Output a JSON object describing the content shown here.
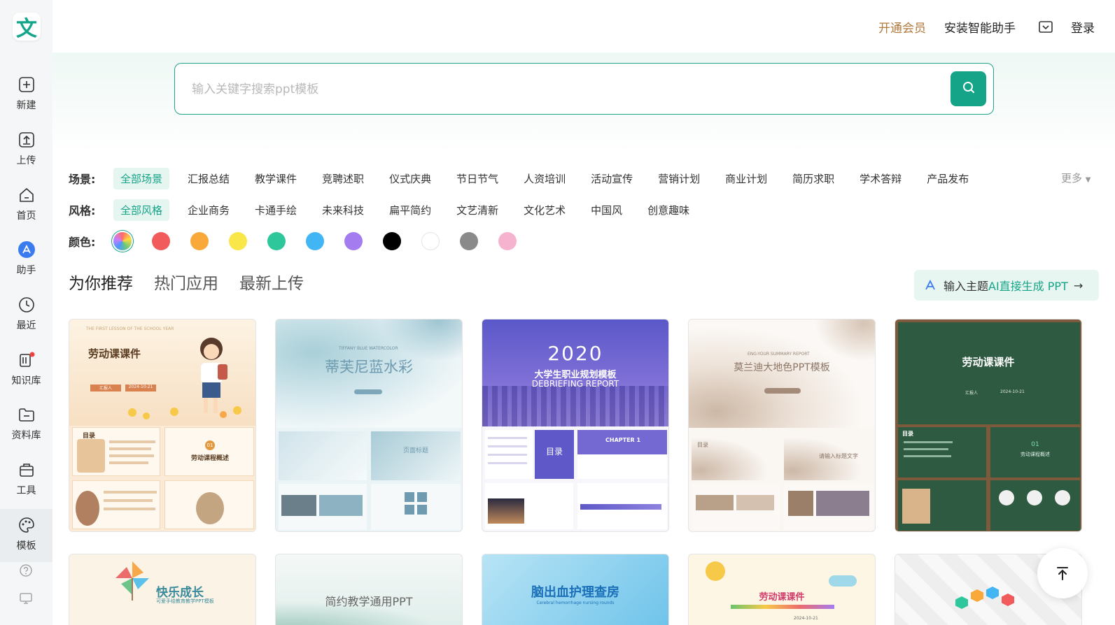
{
  "sidebar": {
    "logo": "文",
    "items": [
      {
        "label": "新建"
      },
      {
        "label": "上传"
      },
      {
        "label": "首页"
      },
      {
        "label": "助手"
      },
      {
        "label": "最近"
      },
      {
        "label": "知识库"
      },
      {
        "label": "资料库"
      },
      {
        "label": "工具"
      },
      {
        "label": "模板"
      }
    ],
    "help_icon": "question-icon",
    "device_icon": "monitor-icon"
  },
  "header": {
    "vip": "开通会员",
    "install": "安装智能助手",
    "login": "登录"
  },
  "search": {
    "placeholder": "输入关键字搜索ppt模板"
  },
  "filters": {
    "scene_label": "场景:",
    "scenes": [
      "全部场景",
      "汇报总结",
      "教学课件",
      "竞聘述职",
      "仪式庆典",
      "节日节气",
      "人资培训",
      "活动宣传",
      "营销计划",
      "商业计划",
      "简历求职",
      "学术答辩",
      "产品发布"
    ],
    "more": "更多",
    "style_label": "风格:",
    "styles": [
      "全部风格",
      "企业商务",
      "卡通手绘",
      "未来科技",
      "扁平简约",
      "文艺清新",
      "文化艺术",
      "中国风",
      "创意趣味"
    ],
    "color_label": "颜色:",
    "colors": [
      "all",
      "#f25b5b",
      "#f8a93a",
      "#f9e74a",
      "#2ec79b",
      "#42b6f5",
      "#a57cf0",
      "#000000",
      "#ffffff",
      "#8a8a8a",
      "#f6b3d0"
    ]
  },
  "tabs": [
    "为你推荐",
    "热门应用",
    "最新上传"
  ],
  "ai_button": {
    "prefix": "输入主题",
    "highlight": "AI直接生成 PPT"
  },
  "cards_row1": [
    {
      "title": "劳动课课件",
      "sub": "THE FIRST LESSON OF THE SCHOOL YEAR",
      "toc": "目录",
      "sec": "劳动课程概述",
      "num": "01",
      "meta1": "汇报人",
      "meta2": "2024-10-21"
    },
    {
      "title": "蒂芙尼蓝水彩",
      "sub": "TIFFANY BLUE WATERCOLOR",
      "sec": "页面标题"
    },
    {
      "title": "2020",
      "sub1": "大学生职业规划模板",
      "sub2": "DEBRIEFING REPORT",
      "toc": "目录",
      "chapter": "CHAPTER 1"
    },
    {
      "title": "莫兰迪大地色PPT模板",
      "sub": "ENG-YOUR SUMMARY REPORT",
      "toc": "目录",
      "sec": "请输入标题文字"
    },
    {
      "title": "劳动课课件",
      "meta1": "汇报人",
      "meta2": "2024-10-21",
      "toc": "目录",
      "num": "01",
      "sec": "劳动课程概述"
    }
  ],
  "cards_row2": [
    {
      "title": "快乐成长",
      "sub": "可爱手绘教育教学PPT模板"
    },
    {
      "title": "简约教学通用PPT"
    },
    {
      "title": "脑出血护理查房",
      "sub": "Cerebral hemorrhage nursing rounds"
    },
    {
      "title": "劳动课课件",
      "meta": "2024-10-21"
    },
    {
      "title": ""
    }
  ]
}
